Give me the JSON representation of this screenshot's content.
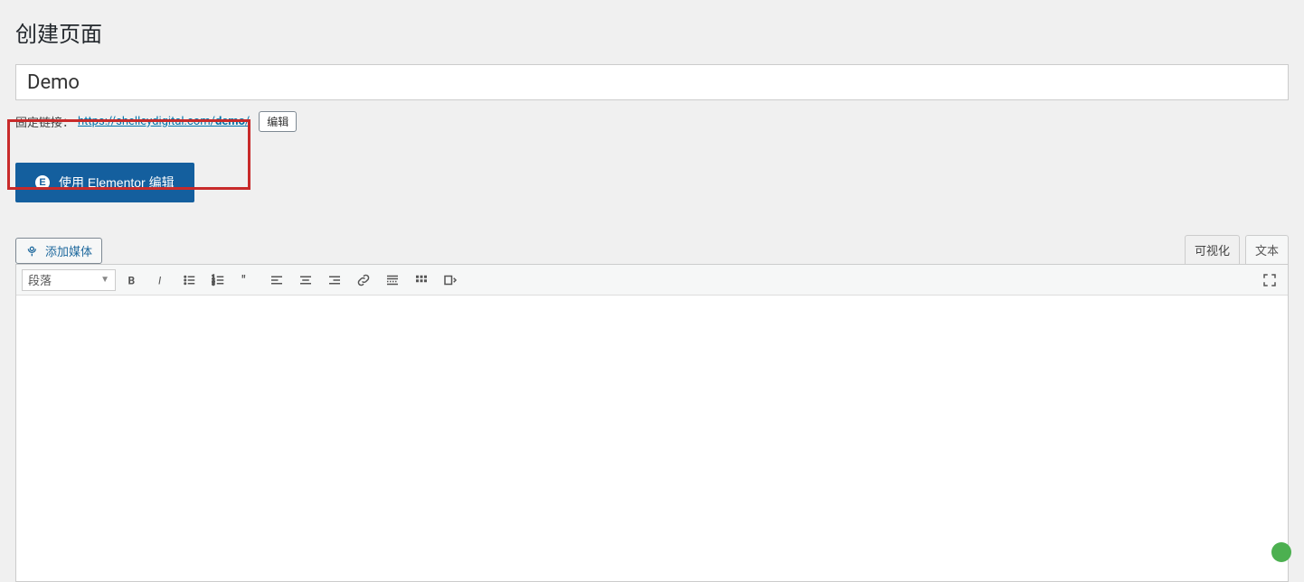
{
  "header": {
    "title": "创建页面"
  },
  "titleInput": {
    "value": "Demo"
  },
  "permalink": {
    "label": "固定链接：",
    "linkPrefix": "https://shelleydigital.com/",
    "linkSlug": "demo",
    "linkSuffix": "/",
    "editLabel": "编辑"
  },
  "elementor": {
    "iconLetter": "E",
    "label": "使用 Elementor 编辑"
  },
  "addMedia": {
    "label": "添加媒体"
  },
  "tabs": {
    "visual": "可视化",
    "text": "文本"
  },
  "toolbar": {
    "paragraphLabel": "段落"
  }
}
